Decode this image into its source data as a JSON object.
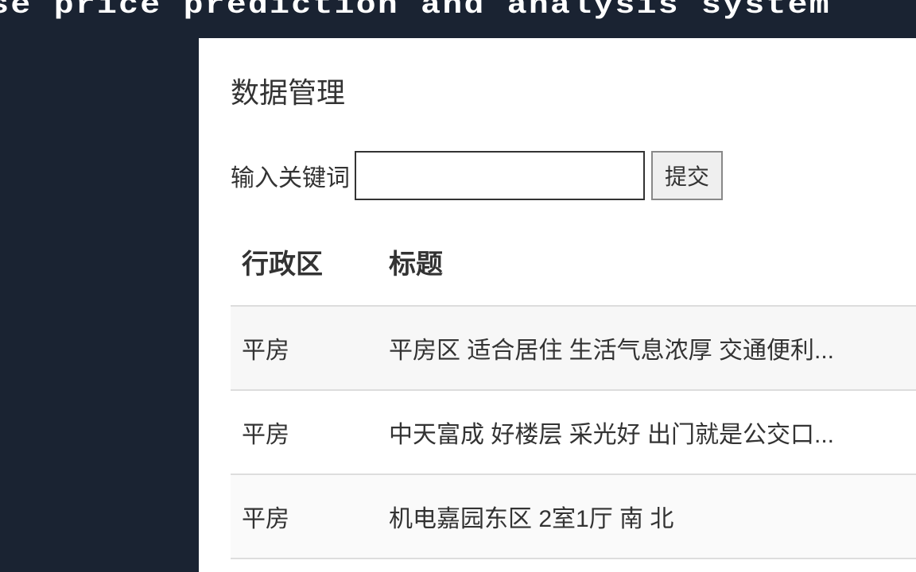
{
  "header": {
    "title": "ouse price prediction and analysis system"
  },
  "page": {
    "title": "数据管理"
  },
  "search": {
    "label": "输入关键词",
    "value": "",
    "submit": "提交"
  },
  "table": {
    "headers": {
      "district": "行政区",
      "title": "标题"
    },
    "rows": [
      {
        "district": "平房",
        "title": "平房区 适合居住 生活气息浓厚 交通便利..."
      },
      {
        "district": "平房",
        "title": "中天富成 好楼层 采光好 出门就是公交口..."
      },
      {
        "district": "平房",
        "title": "机电嘉园东区 2室1厅 南 北"
      }
    ]
  }
}
